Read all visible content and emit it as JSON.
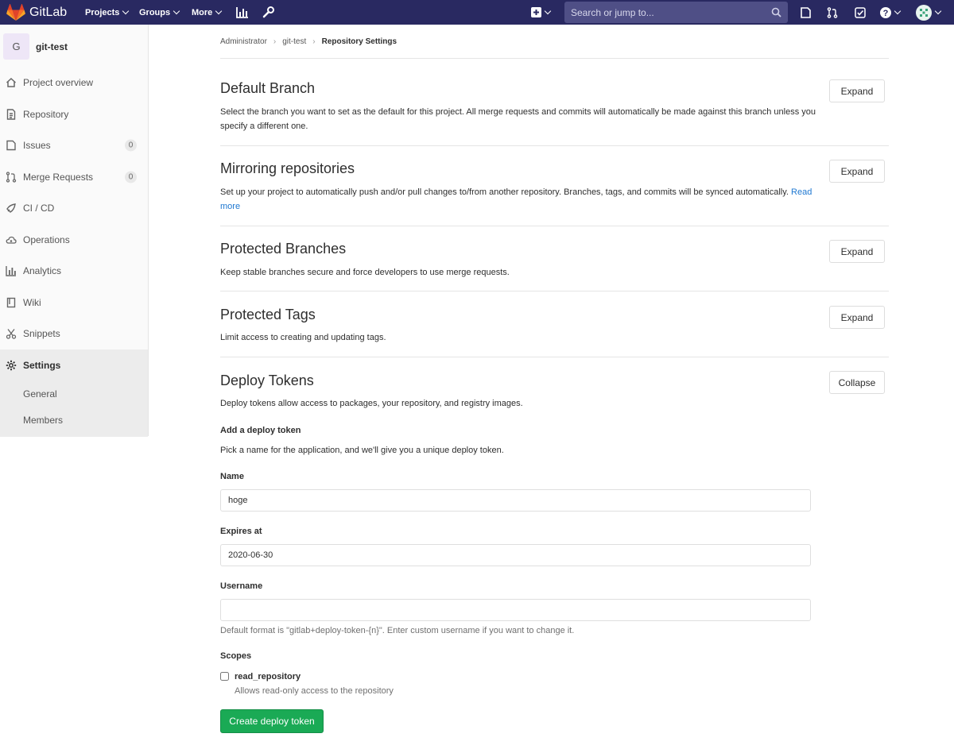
{
  "navbar": {
    "brand": "GitLab",
    "menus": [
      "Projects",
      "Groups",
      "More"
    ],
    "search_placeholder": "Search or jump to...",
    "icons": [
      "gitlab-logo",
      "chart-icon",
      "wrench-icon",
      "plus-square-icon",
      "todo-sidebar-icon",
      "merge-request-icon",
      "check-square-icon",
      "question-icon",
      "avatar"
    ],
    "bg_color": "#292961"
  },
  "sidebar": {
    "project_initial": "G",
    "project_name": "git-test",
    "items": [
      {
        "label": "Project overview",
        "icon": "home-icon"
      },
      {
        "label": "Repository",
        "icon": "doc-icon"
      },
      {
        "label": "Issues",
        "icon": "issues-icon",
        "badge": "0"
      },
      {
        "label": "Merge Requests",
        "icon": "merge-request-icon",
        "badge": "0"
      },
      {
        "label": "CI / CD",
        "icon": "rocket-icon"
      },
      {
        "label": "Operations",
        "icon": "cloud-icon"
      },
      {
        "label": "Analytics",
        "icon": "chart-icon"
      },
      {
        "label": "Wiki",
        "icon": "book-icon"
      },
      {
        "label": "Snippets",
        "icon": "scissors-icon"
      },
      {
        "label": "Settings",
        "icon": "gear-icon",
        "active": true
      }
    ],
    "subitems": [
      "General",
      "Members"
    ]
  },
  "breadcrumb": [
    "Administrator",
    "git-test",
    "Repository Settings"
  ],
  "sections": [
    {
      "title": "Default Branch",
      "desc": "Select the branch you want to set as the default for this project. All merge requests and commits will automatically be made against this branch unless you specify a different one.",
      "button": "Expand"
    },
    {
      "title": "Mirroring repositories",
      "desc": "Set up your project to automatically push and/or pull changes to/from another repository. Branches, tags, and commits will be synced automatically.",
      "link": "Read more",
      "button": "Expand"
    },
    {
      "title": "Protected Branches",
      "desc": "Keep stable branches secure and force developers to use merge requests.",
      "button": "Expand"
    },
    {
      "title": "Protected Tags",
      "desc": "Limit access to creating and updating tags.",
      "button": "Expand"
    },
    {
      "title": "Deploy Tokens",
      "desc": "Deploy tokens allow access to packages, your repository, and registry images.",
      "button": "Collapse"
    }
  ],
  "deploy_form": {
    "heading": "Add a deploy token",
    "intro": "Pick a name for the application, and we'll give you a unique deploy token.",
    "name_label": "Name",
    "name_value": "hoge",
    "expires_label": "Expires at",
    "expires_value": "2020-06-30",
    "username_label": "Username",
    "username_value": "",
    "username_help": "Default format is \"gitlab+deploy-token-{n}\". Enter custom username if you want to change it.",
    "scopes_label": "Scopes",
    "scope_name": "read_repository",
    "scope_help": "Allows read-only access to the repository",
    "scope_checked": false,
    "submit": "Create deploy token"
  },
  "colors": {
    "accent_green": "#1aaa55",
    "link": "#1f78d1",
    "brand_orange": "#e24329"
  }
}
